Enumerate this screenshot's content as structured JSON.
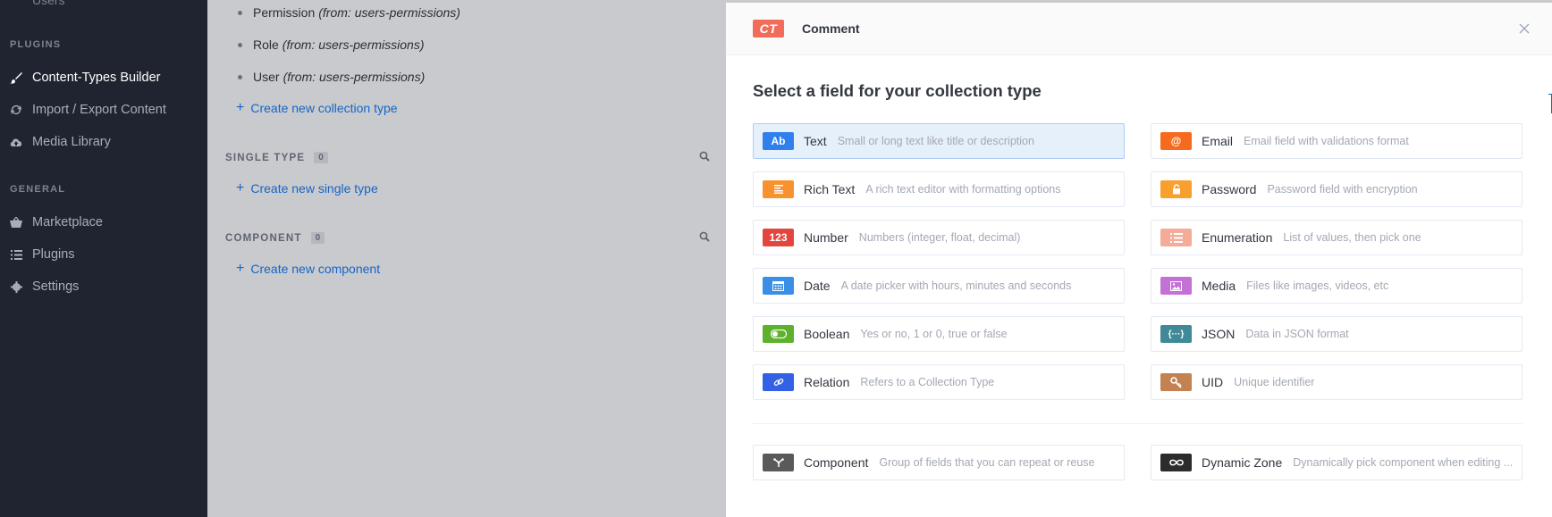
{
  "sidebar": {
    "partial_item": "Users",
    "plugins_heading": "PLUGINS",
    "plugins": [
      {
        "label": "Content-Types Builder",
        "icon": "paintbrush-icon",
        "active": true
      },
      {
        "label": "Import / Export Content",
        "icon": "sync-icon",
        "active": false
      },
      {
        "label": "Media Library",
        "icon": "cloud-upload-icon",
        "active": false
      }
    ],
    "general_heading": "GENERAL",
    "general": [
      {
        "label": "Marketplace",
        "icon": "basket-icon"
      },
      {
        "label": "Plugins",
        "icon": "list-icon"
      },
      {
        "label": "Settings",
        "icon": "gear-icon"
      }
    ]
  },
  "middle": {
    "collection_types": [
      {
        "name": "Permission",
        "from": "(from: users-permissions)"
      },
      {
        "name": "Role",
        "from": "(from: users-permissions)"
      },
      {
        "name": "User",
        "from": "(from: users-permissions)"
      }
    ],
    "create_collection": "Create new collection type",
    "single_type_heading": "SINGLE TYPE",
    "single_type_count": "0",
    "create_single": "Create new single type",
    "component_heading": "COMPONENT",
    "component_count": "0",
    "create_component": "Create new component"
  },
  "modal": {
    "badge": "CT",
    "title": "Comment",
    "heading": "Select a field for your collection type",
    "fields_left": [
      {
        "name": "Text",
        "desc": "Small or long text like title or description",
        "icon_text": "Ab",
        "icon": "text-icon",
        "color": "#2f80ed",
        "selected": true
      },
      {
        "name": "Rich Text",
        "desc": "A rich text editor with formatting options",
        "icon_text": "",
        "icon": "rich-text-icon",
        "color": "#f7922f",
        "selected": false
      },
      {
        "name": "Number",
        "desc": "Numbers (integer, float, decimal)",
        "icon_text": "123",
        "icon": "number-icon",
        "color": "#e2463d",
        "selected": false
      },
      {
        "name": "Date",
        "desc": "A date picker with hours, minutes and seconds",
        "icon_text": "",
        "icon": "calendar-icon",
        "color": "#3a8ee6",
        "selected": false
      },
      {
        "name": "Boolean",
        "desc": "Yes or no, 1 or 0, true or false",
        "icon_text": "",
        "icon": "toggle-icon",
        "color": "#5eb12c",
        "selected": false
      },
      {
        "name": "Relation",
        "desc": "Refers to a Collection Type",
        "icon_text": "",
        "icon": "link-icon",
        "color": "#3361e6",
        "selected": false
      }
    ],
    "fields_right": [
      {
        "name": "Email",
        "desc": "Email field with validations format",
        "icon_text": "@",
        "icon": "at-icon",
        "color": "#f56a1d",
        "selected": false
      },
      {
        "name": "Password",
        "desc": "Password field with encryption",
        "icon_text": "",
        "icon": "lock-icon",
        "color": "#f8a02e",
        "selected": false
      },
      {
        "name": "Enumeration",
        "desc": "List of values, then pick one",
        "icon_text": "",
        "icon": "list-icon",
        "color": "#f4ab98",
        "selected": false
      },
      {
        "name": "Media",
        "desc": "Files like images, videos, etc",
        "icon_text": "",
        "icon": "image-icon",
        "color": "#c471d6",
        "selected": false
      },
      {
        "name": "JSON",
        "desc": "Data in JSON format",
        "icon_text": "{···}",
        "icon": "json-icon",
        "color": "#3f8a96",
        "selected": false
      },
      {
        "name": "UID",
        "desc": "Unique identifier",
        "icon_text": "",
        "icon": "key-icon",
        "color": "#c48252",
        "selected": false
      }
    ],
    "component_field": {
      "name": "Component",
      "desc": "Group of fields that you can repeat or reuse",
      "icon": "component-icon",
      "color": "#5a5a5a"
    },
    "dynamic_zone_field": {
      "name": "Dynamic Zone",
      "desc": "Dynamically pick component when editing ...",
      "icon": "infinity-icon",
      "color": "#2c2c2c"
    }
  }
}
